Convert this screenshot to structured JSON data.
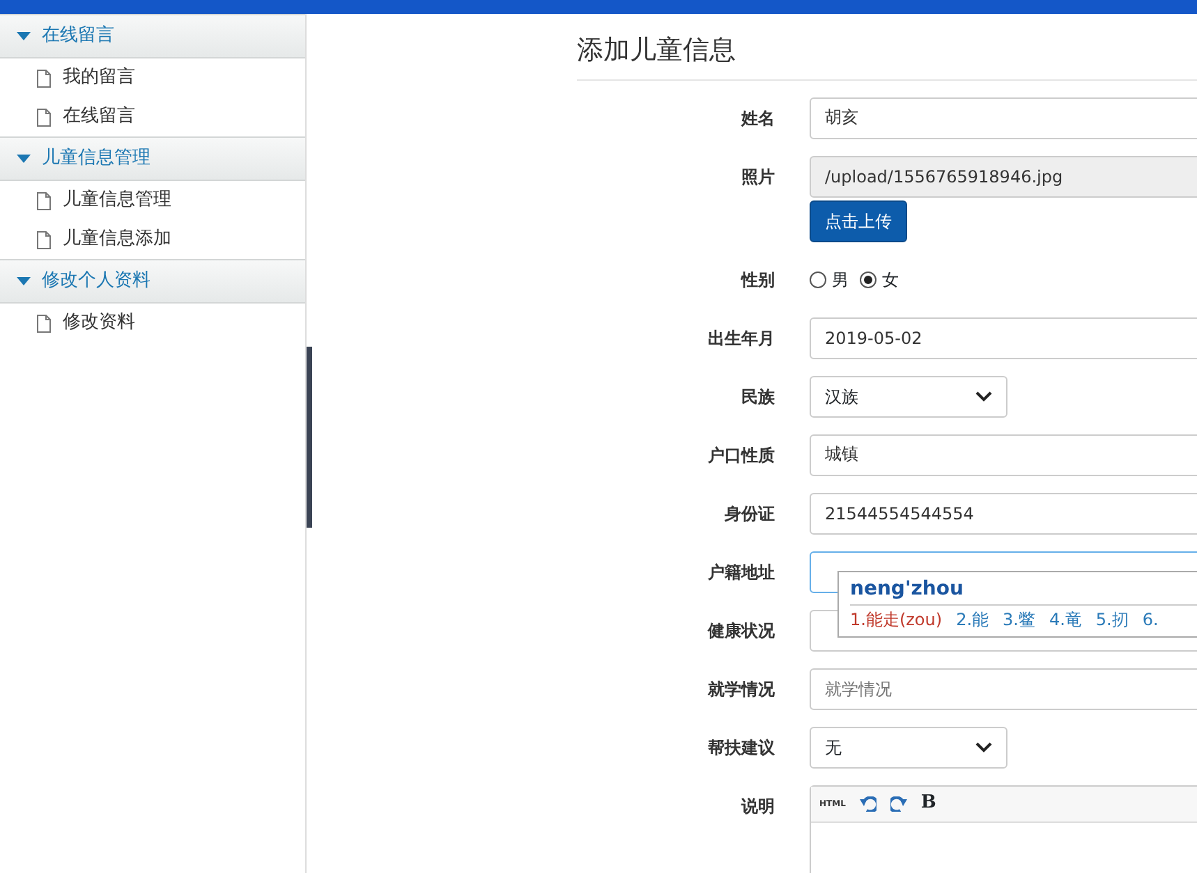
{
  "sidebar": {
    "groups": [
      {
        "title": "在线留言",
        "expanded": true,
        "items": [
          "我的留言",
          "在线留言"
        ]
      },
      {
        "title": "儿童信息管理",
        "expanded": true,
        "items": [
          "儿童信息管理",
          "儿童信息添加"
        ]
      },
      {
        "title": "修改个人资料",
        "expanded": true,
        "items": [
          "修改资料"
        ]
      }
    ]
  },
  "page_title": "添加儿童信息",
  "form": [
    {
      "kind": "text",
      "label": "姓名",
      "value": "胡亥"
    },
    {
      "kind": "file",
      "label": "照片",
      "value": "/upload/1556765918946.jpg",
      "button": "点击上传"
    },
    {
      "kind": "radio",
      "label": "性别",
      "options": [
        {
          "label": "男",
          "selected": false
        },
        {
          "label": "女",
          "selected": true
        }
      ]
    },
    {
      "kind": "text",
      "label": "出生年月",
      "value": "2019-05-02"
    },
    {
      "kind": "select",
      "label": "民族",
      "value": "汉族"
    },
    {
      "kind": "text",
      "label": "户口性质",
      "value": "城镇"
    },
    {
      "kind": "text",
      "label": "身份证",
      "value": "21544554544554"
    },
    {
      "kind": "text",
      "label": "户籍地址",
      "focused": true
    },
    {
      "kind": "text",
      "label": "健康状况"
    },
    {
      "kind": "text",
      "label": "就学情况",
      "placeholder": "就学情况"
    },
    {
      "kind": "select",
      "label": "帮扶建议",
      "value": "无"
    },
    {
      "kind": "editor",
      "label": "说明",
      "toolbar": [
        {
          "kind": "html",
          "text": "HTML"
        },
        {
          "kind": "undo"
        },
        {
          "kind": "redo"
        },
        {
          "kind": "bold",
          "text": "B"
        }
      ]
    }
  ],
  "ime": {
    "input": "neng'zhou",
    "candidates": [
      {
        "label": "1.能走(zou)",
        "selected": true
      },
      {
        "label": "2.能",
        "selected": false
      },
      {
        "label": "3.鳖",
        "selected": false
      },
      {
        "label": "4.竜",
        "selected": false
      },
      {
        "label": "5.扨",
        "selected": false
      },
      {
        "label": "6.",
        "selected": false
      }
    ]
  }
}
